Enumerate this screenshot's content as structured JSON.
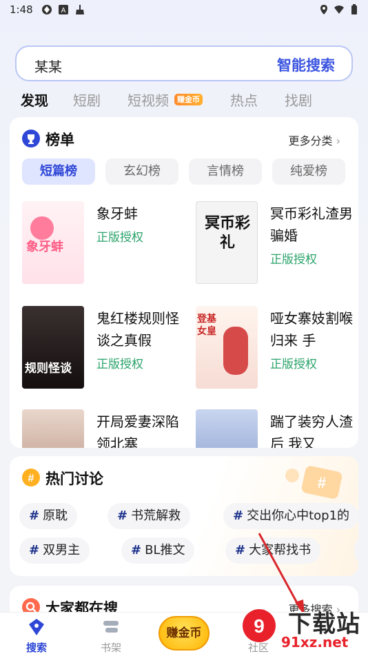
{
  "status_bar": {
    "time": "1:48"
  },
  "search": {
    "query": "某某",
    "action_label": "智能搜索"
  },
  "tabs": [
    {
      "label": "发现",
      "active": true
    },
    {
      "label": "短剧"
    },
    {
      "label": "短视频",
      "badge": "赚金币"
    },
    {
      "label": "热点"
    },
    {
      "label": "找剧"
    }
  ],
  "rank": {
    "title": "榜单",
    "more": "更多分类",
    "pills": [
      "短篇榜",
      "玄幻榜",
      "言情榜",
      "纯爱榜"
    ],
    "books": [
      {
        "title": "象牙蚌",
        "sub": "正版授权",
        "cover_text": "象牙蚌"
      },
      {
        "title": "冥币彩礼渣男骗婚",
        "sub": "正版授权",
        "cover_text": "冥币彩礼"
      },
      {
        "title": "鬼红楼规则怪谈之真假",
        "sub": "正版授权",
        "cover_text": "规则怪谈"
      },
      {
        "title": "哑女寨妓割喉归来 手",
        "sub": "正版授权",
        "cover_text": "登基女皇"
      },
      {
        "title": "开局爱妻深陷领北塞",
        "sub": ""
      },
      {
        "title": "踹了装穷人渣后 我又",
        "sub": ""
      }
    ]
  },
  "hot": {
    "title": "热门讨论",
    "tags": [
      "原耽",
      "书荒解救",
      "交出你心中top1的",
      "双男主",
      "BL推文",
      "大家帮找书"
    ]
  },
  "searching": {
    "title": "大家都在搜",
    "more": "更多搜索"
  },
  "bottom_nav": [
    {
      "label": "搜索",
      "active": true
    },
    {
      "label": "书架"
    },
    {
      "label": "赚金币"
    },
    {
      "label": "社区"
    }
  ],
  "watermark": {
    "main": "下载站",
    "sub": "91xz.net"
  },
  "colors": {
    "accent": "#2e47d6",
    "license_green": "#2aa36a",
    "coin": "#ffb400"
  }
}
